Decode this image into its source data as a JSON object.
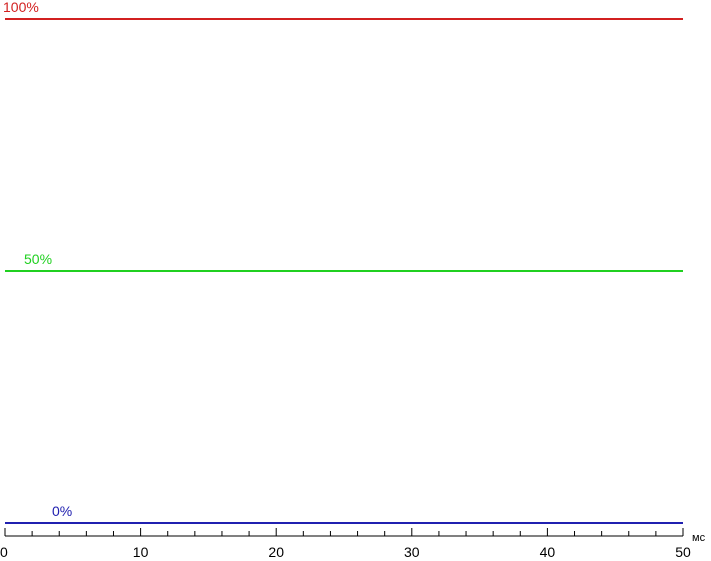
{
  "chart_data": {
    "type": "line",
    "title": "",
    "xlabel": "",
    "ylabel": "",
    "x_unit": "мс",
    "xlim": [
      0,
      50
    ],
    "ylim": [
      0,
      100
    ],
    "x_ticks_major": [
      0,
      10,
      20,
      30,
      40,
      50
    ],
    "x_ticks_minor_step": 2,
    "grid": false,
    "legend": "none",
    "series": [
      {
        "name": "100%",
        "color": "#d22020",
        "x": [
          0,
          50
        ],
        "y": [
          100,
          100
        ]
      },
      {
        "name": "50%",
        "color": "#20d020",
        "x": [
          0,
          50
        ],
        "y": [
          50,
          50
        ]
      },
      {
        "name": "0%",
        "color": "#2020b0",
        "x": [
          0,
          50
        ],
        "y": [
          0,
          0
        ]
      }
    ]
  }
}
